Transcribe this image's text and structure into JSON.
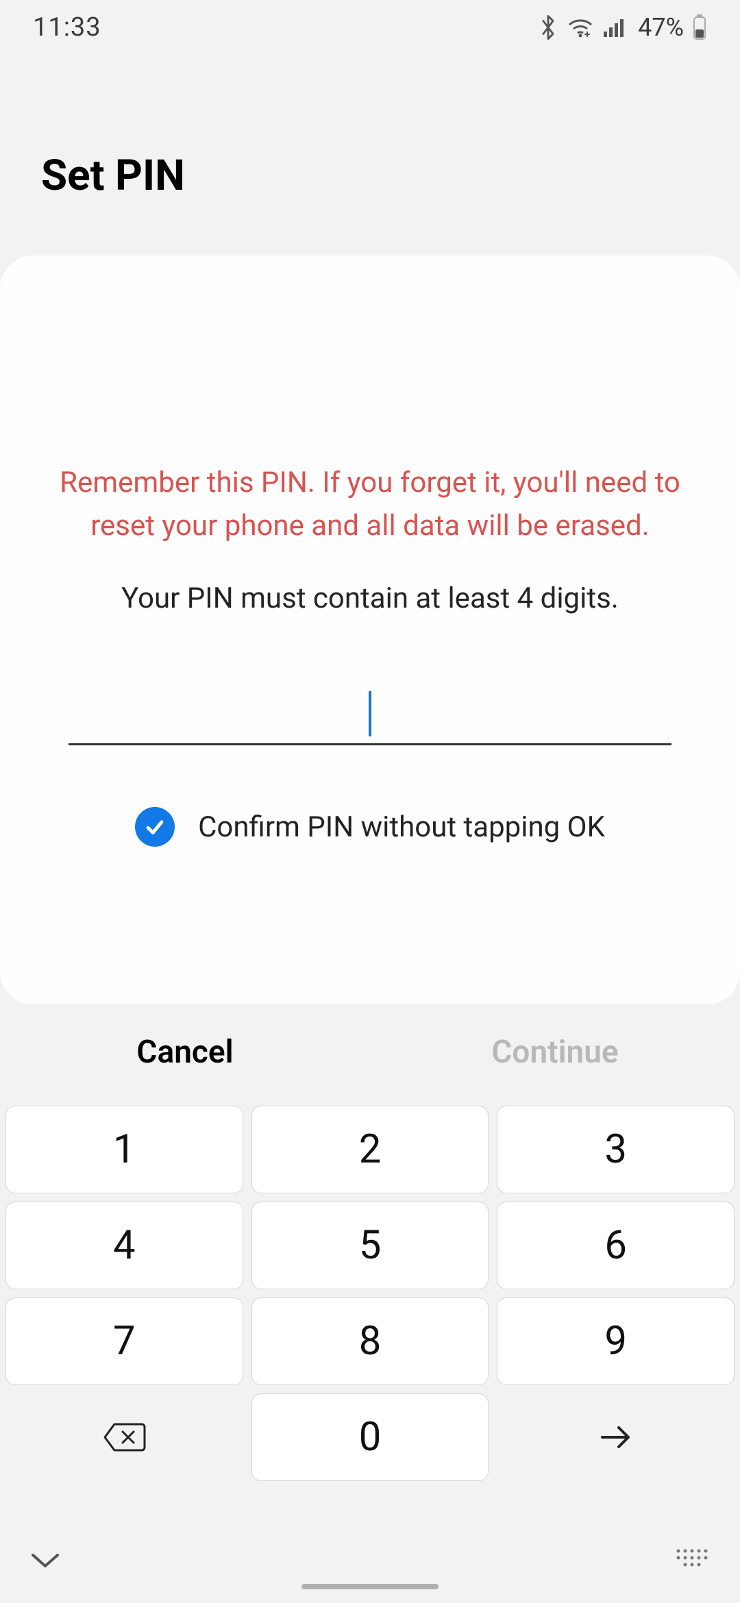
{
  "status": {
    "time": "11:33",
    "battery_percent": "47%"
  },
  "header": {
    "title": "Set PIN"
  },
  "card": {
    "warning": "Remember this PIN. If you forget it, you'll need to reset your phone and all data will be erased.",
    "hint": "Your PIN must contain at least 4 digits.",
    "pin_value": "",
    "confirm_label": "Confirm PIN without tapping OK",
    "confirm_checked": true
  },
  "actions": {
    "cancel": "Cancel",
    "continue": "Continue",
    "continue_enabled": false
  },
  "keypad": {
    "keys": [
      "1",
      "2",
      "3",
      "4",
      "5",
      "6",
      "7",
      "8",
      "9"
    ],
    "zero": "0"
  }
}
